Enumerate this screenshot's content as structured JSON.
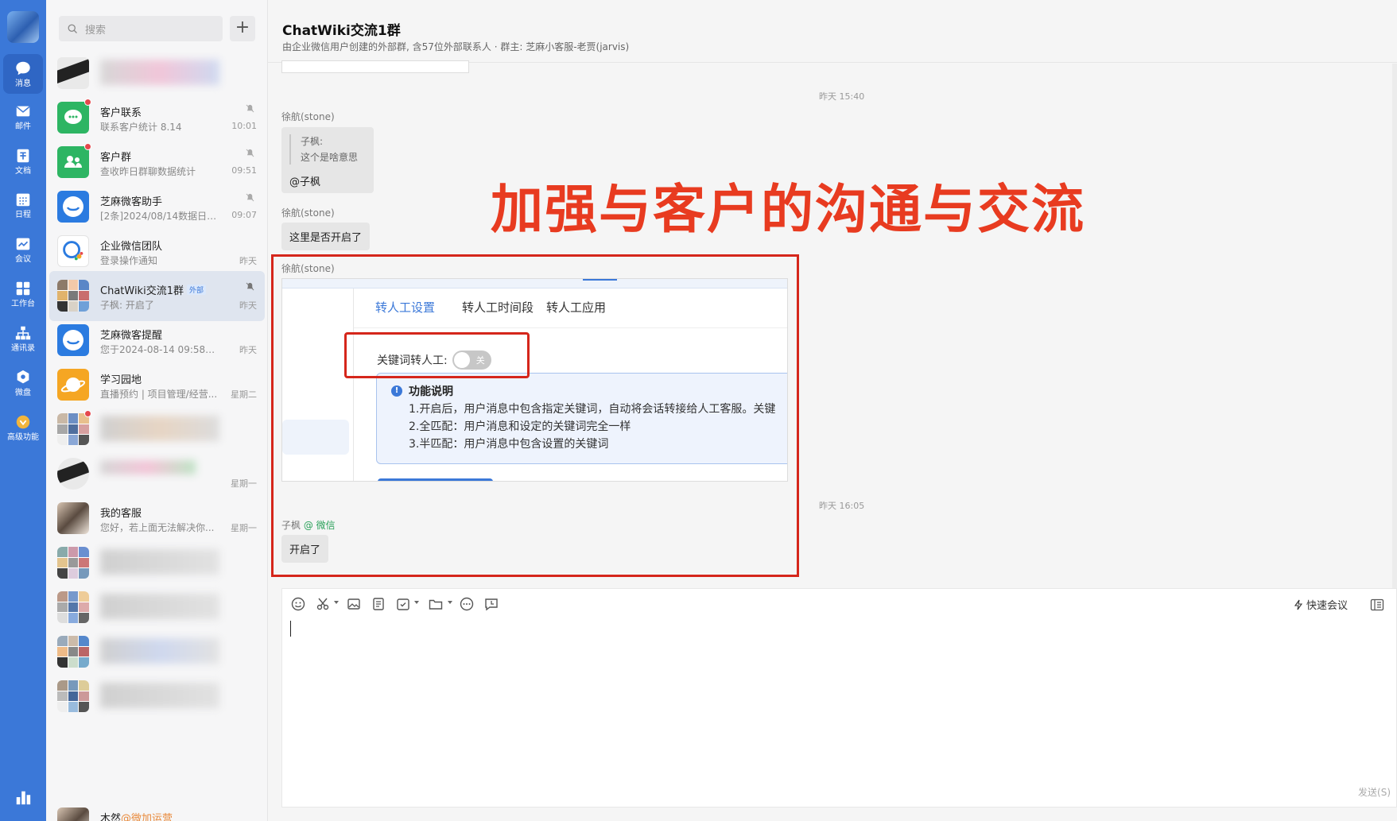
{
  "rail": {
    "items": [
      {
        "label": "消息",
        "icon": "message-icon",
        "active": true
      },
      {
        "label": "邮件",
        "icon": "mail-icon"
      },
      {
        "label": "文档",
        "icon": "doc-icon"
      },
      {
        "label": "日程",
        "icon": "calendar-icon"
      },
      {
        "label": "会议",
        "icon": "meeting-icon"
      },
      {
        "label": "工作台",
        "icon": "workbench-icon"
      },
      {
        "label": "通讯录",
        "icon": "contacts-icon"
      },
      {
        "label": "微盘",
        "icon": "drive-icon"
      },
      {
        "label": "高级功能",
        "icon": "premium-icon"
      }
    ]
  },
  "sessions": {
    "search_placeholder": "搜索",
    "add_label": "+",
    "items": [
      {
        "name": "",
        "preview": "",
        "time": "",
        "blurred": true
      },
      {
        "name": "客户联系",
        "preview": "联系客户统计 8.14",
        "time": "10:01",
        "muted": true,
        "unread": true
      },
      {
        "name": "客户群",
        "preview": "查收昨日群聊数据统计",
        "time": "09:51",
        "muted": true,
        "unread": true
      },
      {
        "name": "芝麻微客助手",
        "preview": "[2条]2024/08/14数据日报 ...",
        "time": "09:07",
        "muted": true
      },
      {
        "name": "企业微信团队",
        "preview": "登录操作通知",
        "time": "昨天"
      },
      {
        "name": "ChatWiki交流1群",
        "tag": "外部",
        "preview": "子枫: 开启了",
        "time": "昨天",
        "muted": true,
        "active": true
      },
      {
        "name": "芝麻微客提醒",
        "preview": "您于2024-08-14 09:58操作...",
        "time": "昨天"
      },
      {
        "name": "学习园地",
        "preview": "直播预约 | 项目管理/经营...",
        "time": "星期二"
      },
      {
        "name": "",
        "preview": "",
        "time": "",
        "blurred": true,
        "unread": true
      },
      {
        "name": "",
        "preview": "",
        "time": "星期一",
        "blurred": true
      },
      {
        "name": "我的客服",
        "preview": "您好，若上面无法解决你...",
        "time": "星期一"
      },
      {
        "name": "",
        "preview": "",
        "time": "",
        "blurred": true
      },
      {
        "name": "",
        "preview": "",
        "time": "",
        "blurred": true
      },
      {
        "name": "",
        "preview": "",
        "time": "",
        "blurred": true
      },
      {
        "name": "",
        "preview": "",
        "time": "",
        "blurred": true
      },
      {
        "name": "木然",
        "name_suffix": "@微加运营",
        "preview": "",
        "time": ""
      }
    ]
  },
  "chat": {
    "title": "ChatWiki交流1群",
    "subtitle": "由企业微信用户创建的外部群, 含57位外部联系人 · 群主: 芝麻小客服-老贾(jarvis)",
    "messages": {
      "ts1": "昨天 15:40",
      "m1_sender": "徐航(stone)",
      "m1_quote_name": "子枫:",
      "m1_quote_text": "这个是啥意思",
      "m1_text": "@子枫",
      "m2_sender": "徐航(stone)",
      "m2_text": "这里是否开启了",
      "m3_sender": "徐航(stone)",
      "ts2": "昨天 16:05",
      "m4_sender": "子枫",
      "m4_source": "@ 微信",
      "m4_text": "开启了"
    },
    "headline": "加强与客户的沟通与交流",
    "screenshot": {
      "tabs": [
        "转人工设置",
        "转人工时间段",
        "转人工应用"
      ],
      "keyword_label": "关键词转人工:",
      "toggle_label": "关",
      "info_title": "功能说明",
      "info_lines": [
        "1.开启后，用户消息中包含指定关键词，自动将会话转接给人工客服。关键",
        "2.全匹配：用户消息和设定的关键词完全一样",
        "3.半匹配：用户消息中包含设置的关键词"
      ]
    }
  },
  "editor": {
    "quick_meeting": "快速会议",
    "send_label": "发送(S)",
    "tools": [
      "emoji-icon",
      "scissors-icon",
      "image-icon",
      "note-icon",
      "todo-icon",
      "folder-icon",
      "more-icon",
      "history-icon"
    ]
  },
  "colors": {
    "rail": "#3b78d8",
    "accent": "#3b78d8",
    "highlight_red": "#d5261b",
    "headline_red": "#e83b20"
  }
}
